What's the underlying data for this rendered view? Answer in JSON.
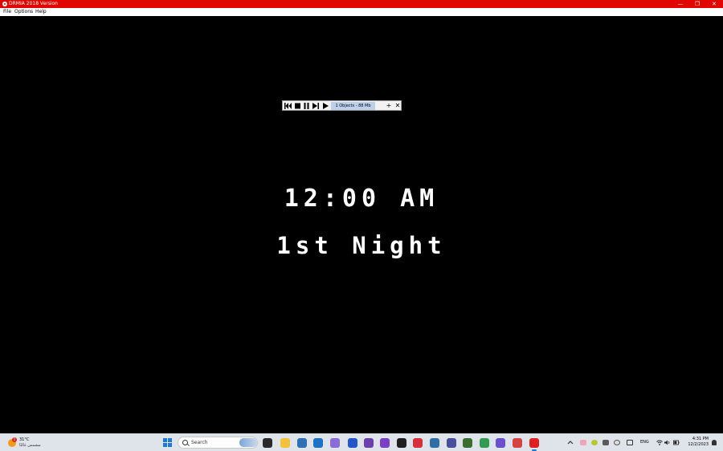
{
  "window": {
    "title": "DRMIA 2018 Version",
    "minimize": "—",
    "maximize": "❐",
    "close": "✕"
  },
  "menu": [
    "File",
    "Options",
    "Help"
  ],
  "debugger": {
    "status": "1 Objects - 88 Mb",
    "add": "+",
    "close": "✕"
  },
  "game": {
    "clock": "12:00 AM",
    "night": "1st Night"
  },
  "taskbar": {
    "weather": {
      "temp": "31°C",
      "condition": "مشمس غالبًا",
      "badge": "1"
    },
    "search_placeholder": "Search",
    "apps": [
      {
        "icon": "task-view-icon",
        "color": "#2a2a2a"
      },
      {
        "icon": "file-explorer-icon",
        "color": "#f3c13a"
      },
      {
        "icon": "store-icon",
        "color": "#2f6fb5"
      },
      {
        "icon": "outlook-icon",
        "color": "#1a73c7"
      },
      {
        "icon": "copilot-icon",
        "color": "#8a6bd8"
      },
      {
        "icon": "app-blue-icon",
        "color": "#2357c9"
      },
      {
        "icon": "app-purple-icon",
        "color": "#6e3fb0"
      },
      {
        "icon": "headphones-icon",
        "color": "#7a3fc6"
      },
      {
        "icon": "stock-app-icon",
        "color": "#1f1f1f"
      },
      {
        "icon": "red-app-icon",
        "color": "#d6303a"
      },
      {
        "icon": "chart-app-icon",
        "color": "#2e6fa8"
      },
      {
        "icon": "settings-app-icon",
        "color": "#4a4f9a"
      },
      {
        "icon": "minecraft-icon",
        "color": "#3b6d2d"
      },
      {
        "icon": "chrome-icon",
        "color": "#2f9c52"
      },
      {
        "icon": "discord-like-icon",
        "color": "#6a4fd1"
      },
      {
        "icon": "chrome-badge-icon",
        "color": "#d64343"
      },
      {
        "icon": "clickteam-icon",
        "color": "#e02020"
      }
    ],
    "language": "ENG",
    "time": "4:31 PM",
    "date": "12/2/2023"
  }
}
